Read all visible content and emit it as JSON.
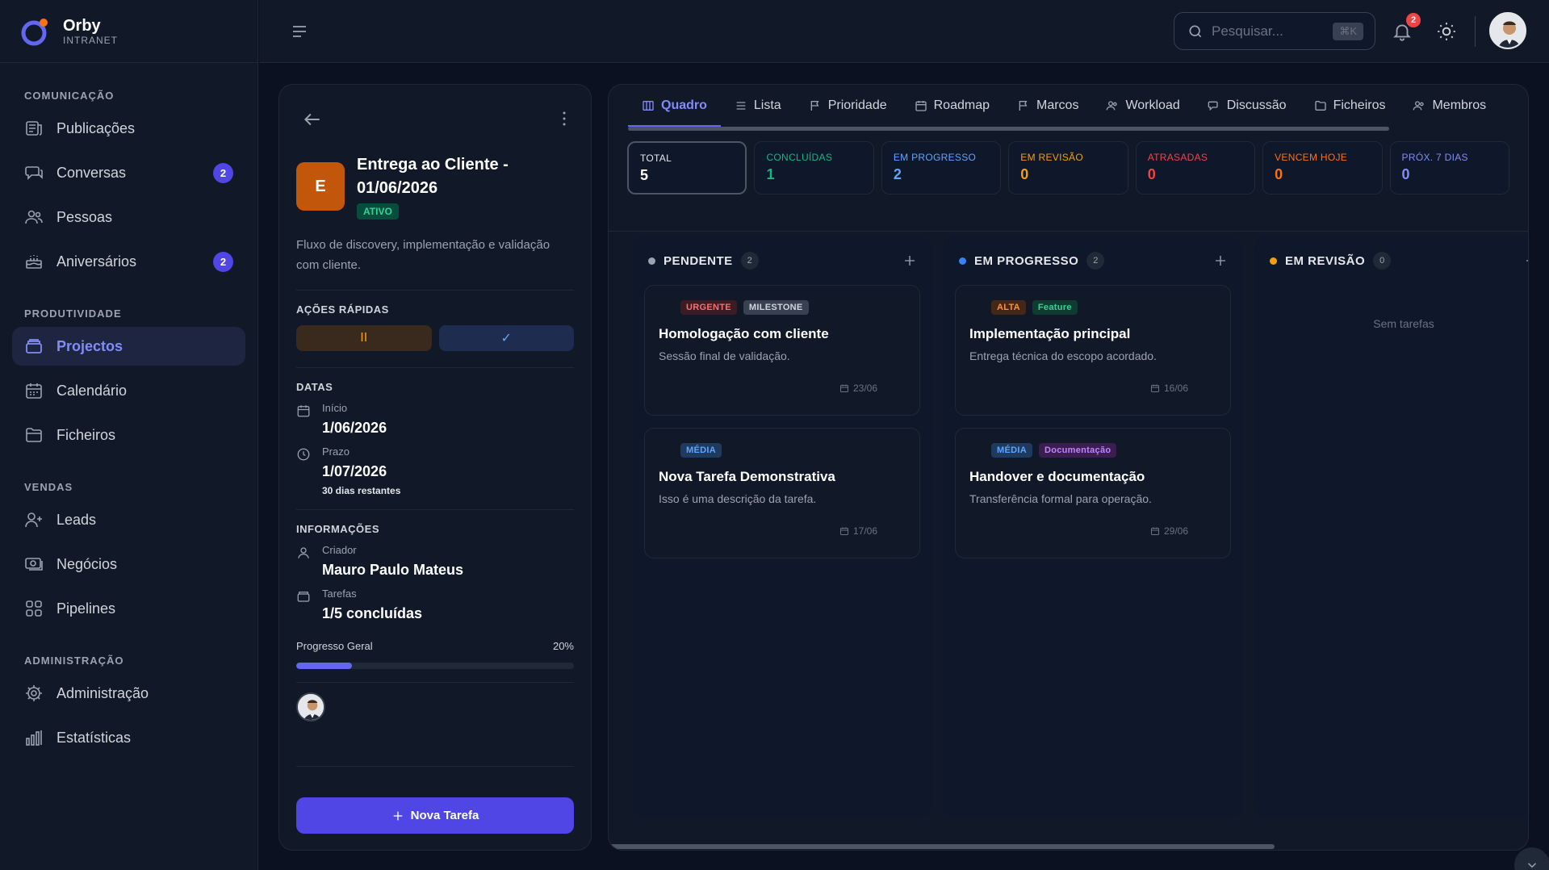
{
  "brand": {
    "name": "Orby",
    "subtitle": "INTRANET"
  },
  "sidebar": {
    "sections": [
      {
        "title": "COMUNICAÇÃO",
        "items": [
          {
            "label": "Publicações",
            "icon": "publications-icon"
          },
          {
            "label": "Conversas",
            "icon": "chat-icon",
            "badge": "2"
          },
          {
            "label": "Pessoas",
            "icon": "people-icon"
          },
          {
            "label": "Aniversários",
            "icon": "cake-icon",
            "badge": "2"
          }
        ]
      },
      {
        "title": "PRODUTIVIDADE",
        "items": [
          {
            "label": "Projectos",
            "icon": "projects-icon",
            "active": true
          },
          {
            "label": "Calendário",
            "icon": "calendar-icon"
          },
          {
            "label": "Ficheiros",
            "icon": "folder-icon"
          }
        ]
      },
      {
        "title": "VENDAS",
        "items": [
          {
            "label": "Leads",
            "icon": "user-plus-icon"
          },
          {
            "label": "Negócios",
            "icon": "money-icon"
          },
          {
            "label": "Pipelines",
            "icon": "grid-icon"
          }
        ]
      },
      {
        "title": "ADMINISTRAÇÃO",
        "items": [
          {
            "label": "Administração",
            "icon": "gear-icon"
          },
          {
            "label": "Estatísticas",
            "icon": "bar-chart-icon"
          }
        ]
      }
    ]
  },
  "topbar": {
    "search_placeholder": "Pesquisar...",
    "search_shortcut": "⌘K",
    "notifications_count": "2"
  },
  "project": {
    "initial": "E",
    "title": "Entrega ao Cliente - 01/06/2026",
    "status": "ATIVO",
    "description": "Fluxo de discovery, implementação e validação com cliente.",
    "quick_actions_title": "AÇÕES RÁPIDAS",
    "pause_label": "II",
    "complete_label": "✓",
    "dates_title": "DATAS",
    "start_label": "Início",
    "start_value": "1/06/2026",
    "deadline_label": "Prazo",
    "deadline_value": "1/07/2026",
    "deadline_remaining": "30 dias restantes",
    "info_title": "INFORMAÇÕES",
    "creator_label": "Criador",
    "creator_value": "Mauro Paulo Mateus",
    "tasks_label": "Tarefas",
    "tasks_value": "1/5 concluídas",
    "progress_label": "Progresso Geral",
    "progress_percent": "20%",
    "progress_value": 20,
    "new_task_label": "Nova Tarefa"
  },
  "board": {
    "tabs": [
      {
        "label": "Quadro",
        "icon": "board-icon",
        "active": true
      },
      {
        "label": "Lista",
        "icon": "list-icon"
      },
      {
        "label": "Prioridade",
        "icon": "flag-icon"
      },
      {
        "label": "Roadmap",
        "icon": "calendar-icon"
      },
      {
        "label": "Marcos",
        "icon": "flag-icon"
      },
      {
        "label": "Workload",
        "icon": "people-icon"
      },
      {
        "label": "Discussão",
        "icon": "chat-icon"
      },
      {
        "label": "Ficheiros",
        "icon": "folder-icon"
      },
      {
        "label": "Membros",
        "icon": "people-icon"
      }
    ],
    "stats": [
      {
        "label": "TOTAL",
        "value": "5",
        "color": "#e5e7eb",
        "selected": true
      },
      {
        "label": "CONCLUÍDAS",
        "value": "1",
        "color": "#10b981"
      },
      {
        "label": "EM PROGRESSO",
        "value": "2",
        "color": "#60a5fa"
      },
      {
        "label": "EM REVISÃO",
        "value": "0",
        "color": "#f59e0b"
      },
      {
        "label": "ATRASADAS",
        "value": "0",
        "color": "#ef4444"
      },
      {
        "label": "VENCEM HOJE",
        "value": "0",
        "color": "#f97316"
      },
      {
        "label": "PRÓX. 7 DIAS",
        "value": "0",
        "color": "#818cf8"
      }
    ],
    "columns": [
      {
        "name": "PENDENTE",
        "count": "2",
        "dot": "#9ca3af",
        "cards": [
          {
            "tags": [
              {
                "label": "URGENTE",
                "bg": "#3b1b24",
                "fg": "#f87171"
              },
              {
                "label": "MILESTONE",
                "bg": "#374151",
                "fg": "#d1d5db"
              }
            ],
            "title": "Homologação com cliente",
            "desc": "Sessão final de validação.",
            "date": "23/06"
          },
          {
            "tags": [
              {
                "label": "MÉDIA",
                "bg": "#1e3a5f",
                "fg": "#60a5fa"
              }
            ],
            "title": "Nova Tarefa Demonstrativa",
            "desc": "Isso é uma descrição da tarefa.",
            "date": "17/06"
          }
        ]
      },
      {
        "name": "EM PROGRESSO",
        "count": "2",
        "dot": "#3b82f6",
        "cards": [
          {
            "tags": [
              {
                "label": "ALTA",
                "bg": "#43281a",
                "fg": "#fb923c"
              },
              {
                "label": "Feature",
                "bg": "#0f3b30",
                "fg": "#34d399"
              }
            ],
            "title": "Implementação principal",
            "desc": "Entrega técnica do escopo acordado.",
            "date": "16/06"
          },
          {
            "tags": [
              {
                "label": "MÉDIA",
                "bg": "#1e3a5f",
                "fg": "#60a5fa"
              },
              {
                "label": "Documentação",
                "bg": "#3b1d4f",
                "fg": "#c084fc"
              }
            ],
            "title": "Handover e documentação",
            "desc": "Transferência formal para operação.",
            "date": "29/06"
          }
        ]
      },
      {
        "name": "EM REVISÃO",
        "count": "0",
        "dot": "#f59e0b",
        "empty_text": "Sem tarefas",
        "cards": []
      }
    ]
  }
}
